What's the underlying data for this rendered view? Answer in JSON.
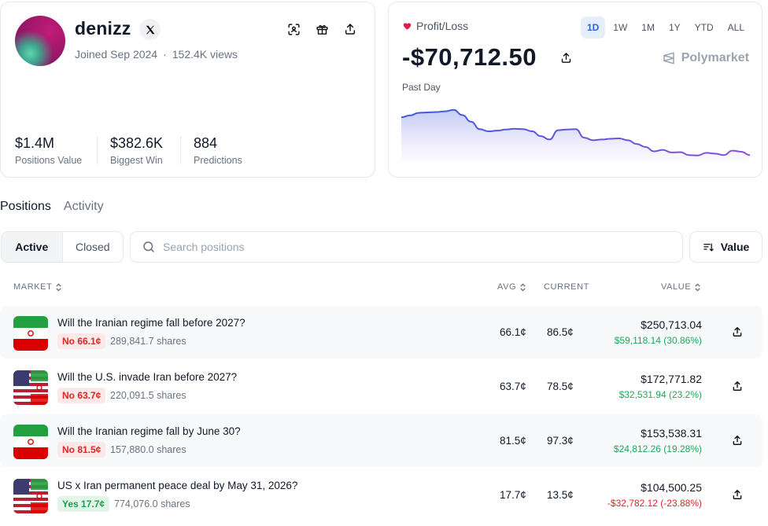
{
  "profile": {
    "username": "denizz",
    "joined": "Joined Sep 2024",
    "views": "152.4K views",
    "stats": [
      {
        "value": "$1.4M",
        "label": "Positions Value"
      },
      {
        "value": "$382.6K",
        "label": "Biggest Win"
      },
      {
        "value": "884",
        "label": "Predictions"
      }
    ]
  },
  "pnl": {
    "label": "Profit/Loss",
    "value": "-$70,712.50",
    "brand": "Polymarket",
    "range_label": "Past Day",
    "timeframes": [
      "1D",
      "1W",
      "1M",
      "1Y",
      "YTD",
      "ALL"
    ],
    "active_timeframe": "1D",
    "colors": {
      "line_start": "#3b5bdb",
      "line_end": "#8b4fd6",
      "heart": "#e11d48"
    }
  },
  "chart_data": {
    "type": "area",
    "x": [
      0,
      1,
      2,
      3,
      4,
      5,
      6,
      7,
      8,
      9,
      10,
      11,
      12,
      13,
      14,
      15,
      16,
      17,
      18,
      19,
      20,
      21,
      22,
      23,
      24,
      25,
      26,
      27,
      28,
      29,
      30,
      31,
      32,
      33,
      34,
      35,
      36,
      37,
      38,
      39,
      40
    ],
    "values": [
      -70610,
      -70605,
      -70598,
      -70597,
      -70596,
      -70594,
      -70590,
      -70604,
      -70622,
      -70642,
      -70648,
      -70646,
      -70643,
      -70641,
      -70642,
      -70648,
      -70661,
      -70670,
      -70645,
      -70643,
      -70642,
      -70665,
      -70672,
      -70670,
      -70668,
      -70667,
      -70672,
      -70682,
      -70690,
      -70702,
      -70698,
      -70705,
      -70704,
      -70712,
      -70713,
      -70706,
      -70708,
      -70712,
      -70700,
      -70703,
      -70712
    ],
    "ylim": [
      -70720,
      -70580
    ],
    "grid": false
  },
  "tabs": [
    "Positions",
    "Activity"
  ],
  "filters": {
    "active_label": "Active",
    "closed_label": "Closed"
  },
  "search": {
    "placeholder": "Search positions",
    "value": ""
  },
  "sort_label": "Value",
  "columns": {
    "market": "MARKET",
    "avg": "AVG",
    "current": "CURRENT",
    "value": "VALUE"
  },
  "positions": [
    {
      "title": "Will the Iranian regime fall before 2027?",
      "flag": "iran",
      "outcome": "No 66.1¢",
      "side": "no",
      "shares": "289,841.7 shares",
      "avg": "66.1¢",
      "current": "86.5¢",
      "value": "$250,713.04",
      "pnl": "$59,118.14 (30.86%)",
      "pnl_sign": "pos"
    },
    {
      "title": "Will the U.S. invade Iran before 2027?",
      "flag": "us-iran",
      "outcome": "No 63.7¢",
      "side": "no",
      "shares": "220,091.5 shares",
      "avg": "63.7¢",
      "current": "78.5¢",
      "value": "$172,771.82",
      "pnl": "$32,531.94 (23.2%)",
      "pnl_sign": "pos"
    },
    {
      "title": "Will the Iranian regime fall by June 30?",
      "flag": "iran",
      "outcome": "No 81.5¢",
      "side": "no",
      "shares": "157,880.0 shares",
      "avg": "81.5¢",
      "current": "97.3¢",
      "value": "$153,538.31",
      "pnl": "$24,812.26 (19.28%)",
      "pnl_sign": "pos"
    },
    {
      "title": "US x Iran permanent peace deal by May 31, 2026?",
      "flag": "us-iran",
      "outcome": "Yes 17.7¢",
      "side": "yes",
      "shares": "774,076.0 shares",
      "avg": "17.7¢",
      "current": "13.5¢",
      "value": "$104,500.25",
      "pnl": "-$32,782.12 (-23.88%)",
      "pnl_sign": "neg"
    }
  ]
}
